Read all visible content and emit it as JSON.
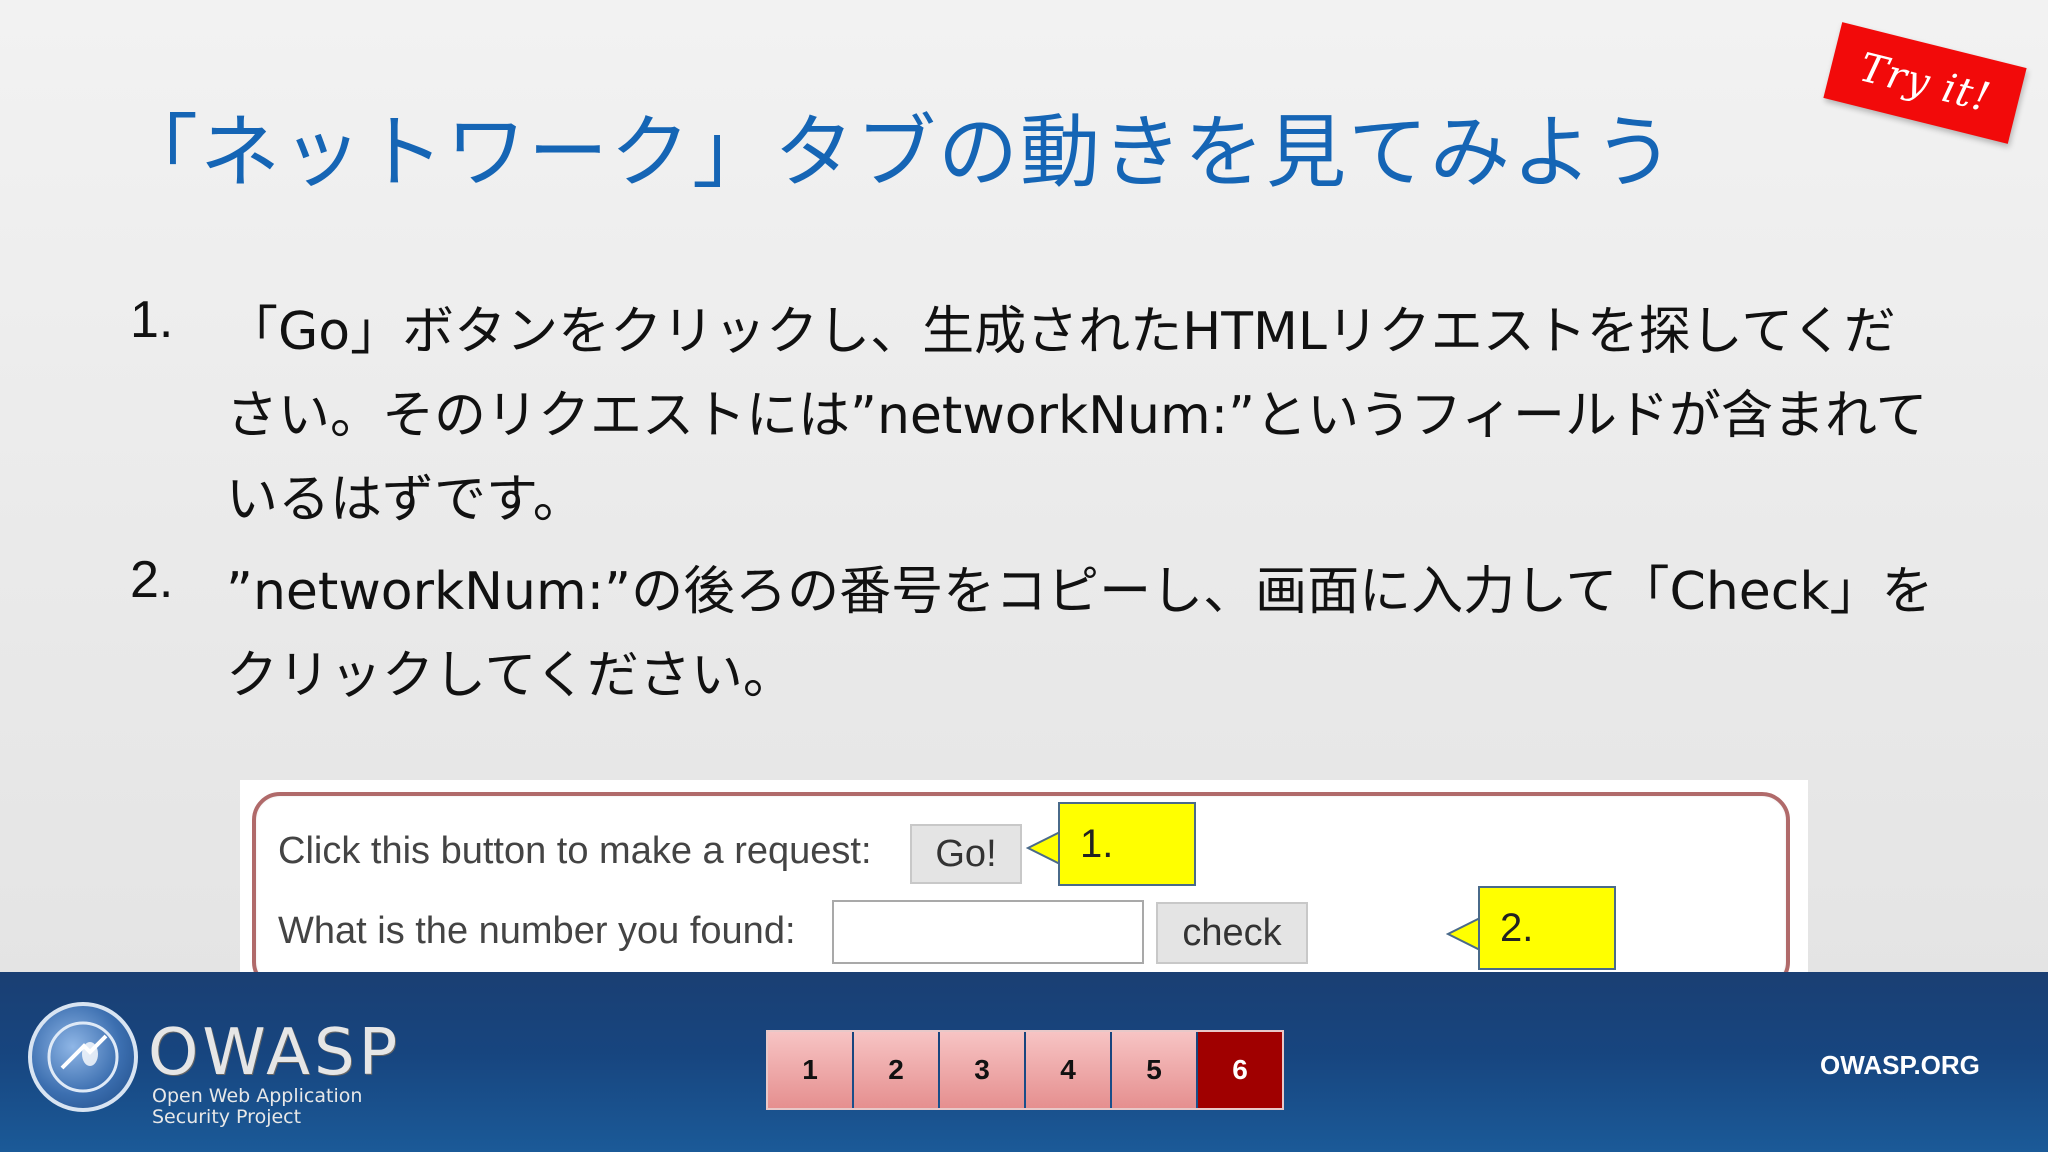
{
  "slide": {
    "title": "「ネットワーク」タブの動きを見てみよう",
    "try_it": "Try it!",
    "steps": [
      {
        "number": "1.",
        "text": "「Go」ボタンをクリックし、生成されたHTMLリクエストを探してください。そのリクエストには”networkNum:”というフィールドが含まれているはずです。"
      },
      {
        "number": "2.",
        "text": "”networkNum:”の後ろの番号をコピーし、画面に入力して「Check」をクリックしてください。"
      }
    ]
  },
  "exercise": {
    "request_label": "Click this button to make a request:",
    "go_button": "Go!",
    "number_label": "What is the number you found:",
    "number_value": "",
    "check_button": "check",
    "callout_1": "1.",
    "callout_2": "2.",
    "callout_color": "#ffff00"
  },
  "footer": {
    "logo_text": "OWASP",
    "logo_sub_1": "Open Web Application",
    "logo_sub_2": "Security Project",
    "site": "OWASP.ORG",
    "pages": [
      "1",
      "2",
      "3",
      "4",
      "5",
      "6"
    ],
    "current_page": "6",
    "accent": "#a00000"
  }
}
